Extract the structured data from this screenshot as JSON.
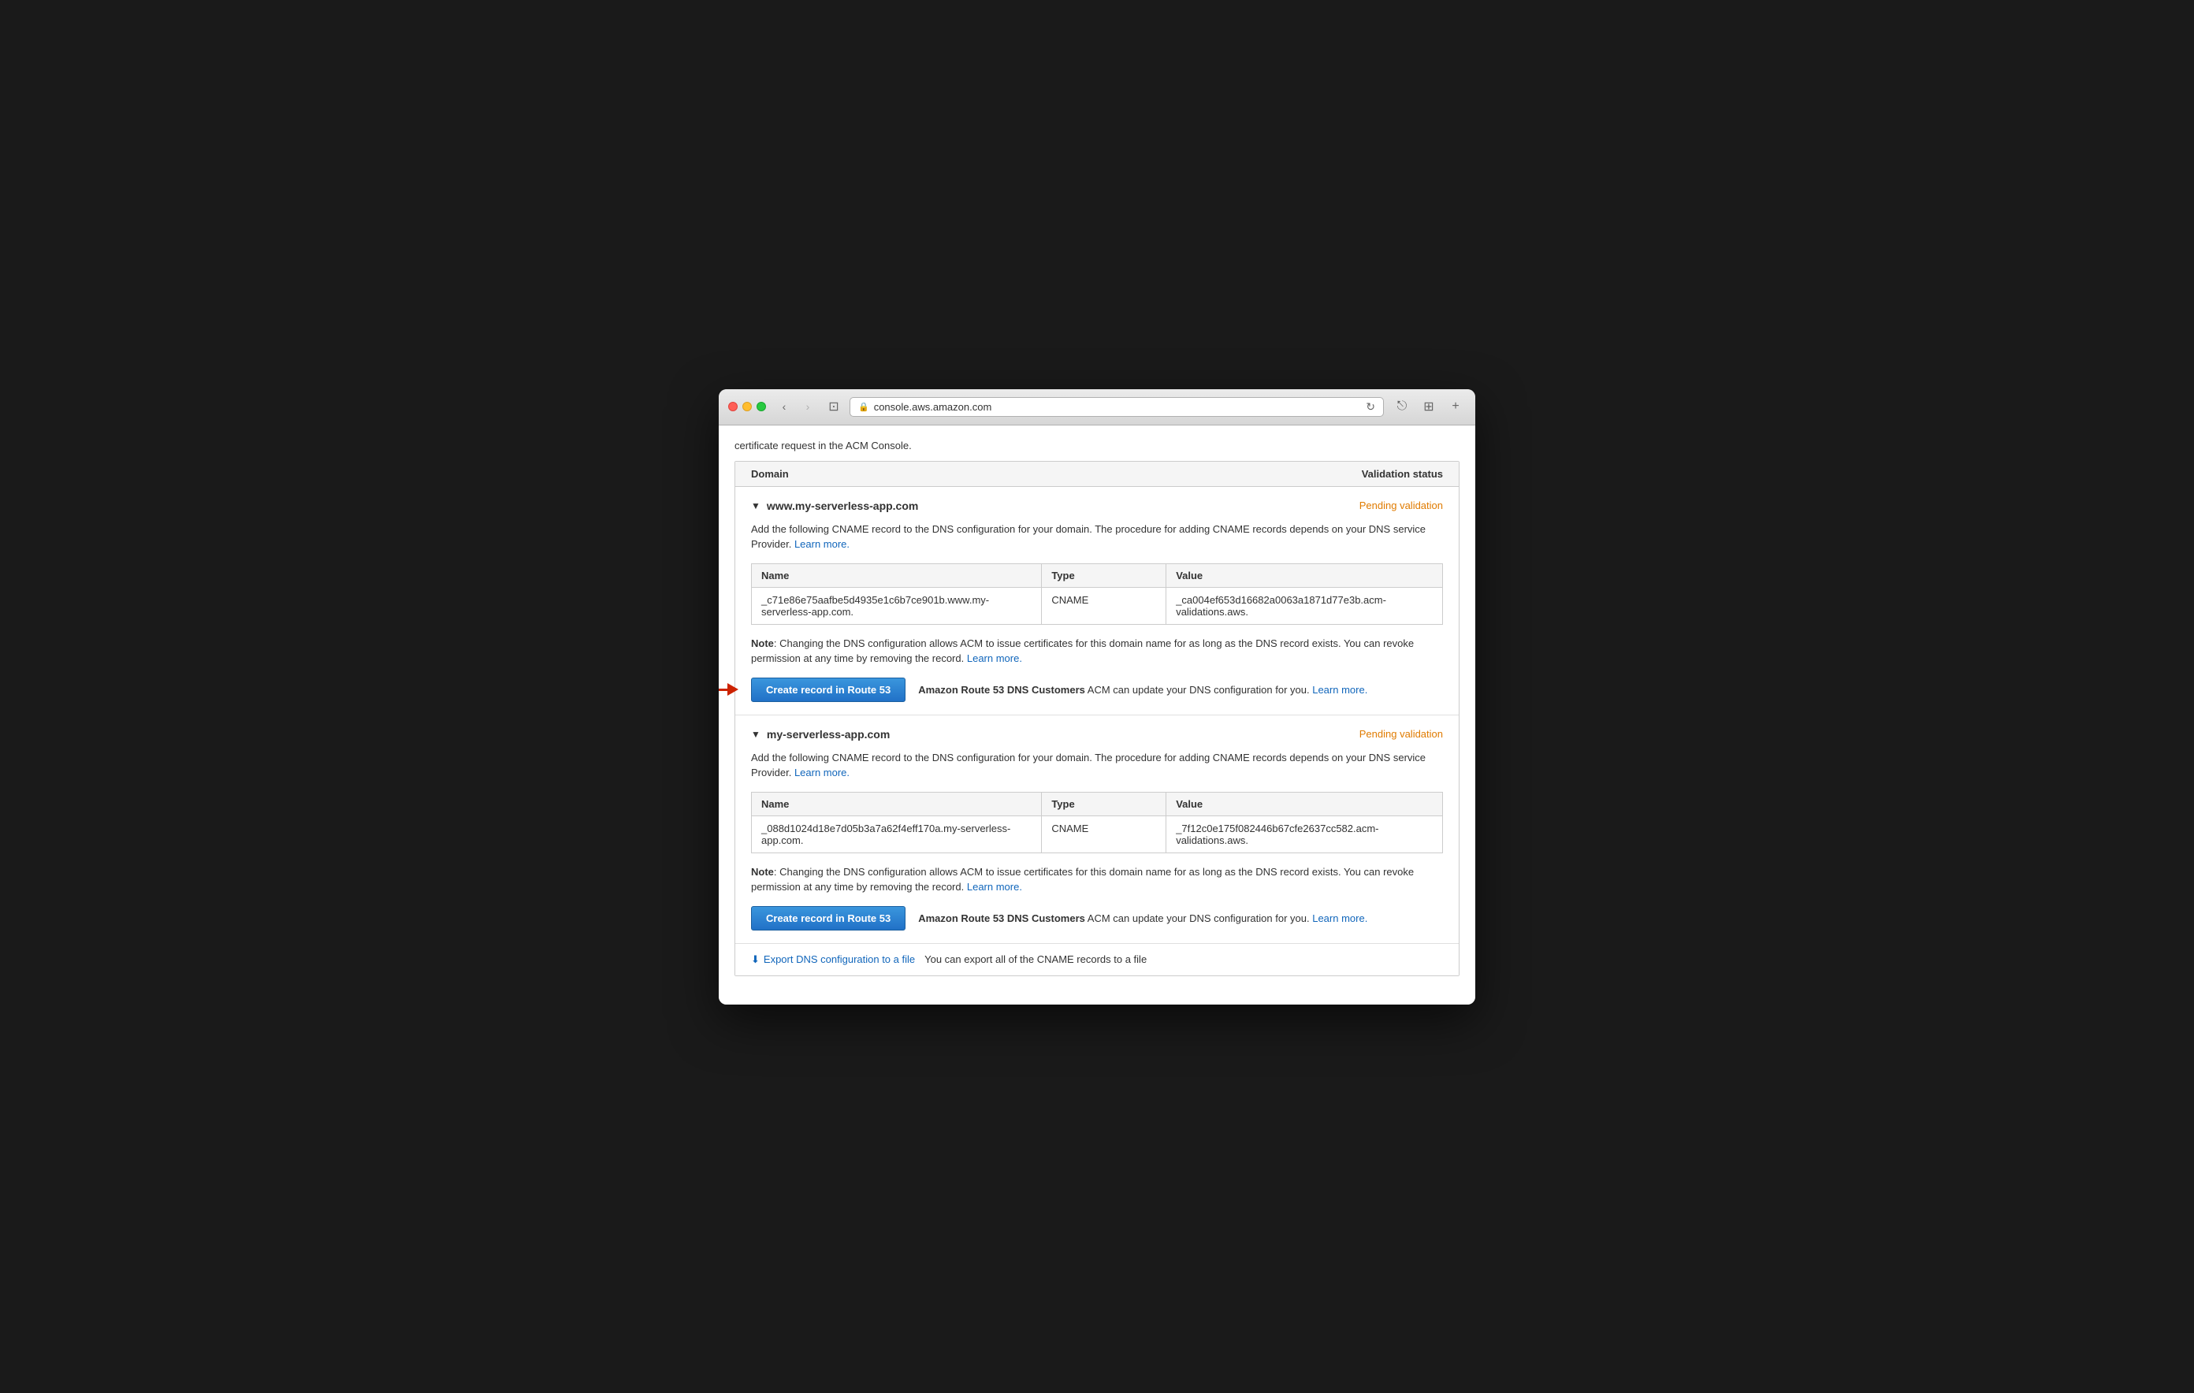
{
  "browser": {
    "url": "console.aws.amazon.com",
    "nav_back_disabled": false,
    "nav_forward_disabled": true
  },
  "page": {
    "cutoff_text": "certificate request in the ACM Console.",
    "table_headers": {
      "domain": "Domain",
      "validation_status": "Validation status"
    },
    "section1": {
      "domain": "www.my-serverless-app.com",
      "validation_status": "Pending validation",
      "description": "Add the following CNAME record to the DNS configuration for your domain. The procedure for adding CNAME records depends on your DNS service Provider.",
      "learn_more_label": "Learn more.",
      "cname_table": {
        "col_name": "Name",
        "col_type": "Type",
        "col_value": "Value",
        "row": {
          "name": "_c71e86e75aafbe5d4935e1c6b7ce901b.www.my-serverless-app.com.",
          "type": "CNAME",
          "value": "_ca004ef653d16682a0063a1871d77e3b.acm-validations.aws."
        }
      },
      "note_text": "Changing the DNS configuration allows ACM to issue certificates for this domain name for as long as the DNS record exists. You can revoke permission at any time by removing the record.",
      "note_learn_more": "Learn more.",
      "create_btn": "Create record in Route 53",
      "customers_label": "Amazon Route 53 DNS Customers",
      "customers_text": "ACM can update your DNS configuration for you.",
      "customers_learn_more": "Learn more."
    },
    "section2": {
      "domain": "my-serverless-app.com",
      "validation_status": "Pending validation",
      "description": "Add the following CNAME record to the DNS configuration for your domain. The procedure for adding CNAME records depends on your DNS service Provider.",
      "learn_more_label": "Learn more.",
      "cname_table": {
        "col_name": "Name",
        "col_type": "Type",
        "col_value": "Value",
        "row": {
          "name": "_088d1024d18e7d05b3a7a62f4eff170a.my-serverless-app.com.",
          "type": "CNAME",
          "value": "_7f12c0e175f082446b67cfe2637cc582.acm-validations.aws."
        }
      },
      "note_text": "Changing the DNS configuration allows ACM to issue certificates for this domain name for as long as the DNS record exists. You can revoke permission at any time by removing the record.",
      "note_learn_more": "Learn more.",
      "create_btn": "Create record in Route 53",
      "customers_label": "Amazon Route 53 DNS Customers",
      "customers_text": "ACM can update your DNS configuration for you.",
      "customers_learn_more": "Learn more."
    },
    "export": {
      "link_text": "Export DNS configuration to a file",
      "description": "You can export all of the CNAME records to a file"
    }
  },
  "icons": {
    "lock": "🔒",
    "reload": "↻",
    "share": "⎋",
    "tabs": "⊞",
    "new_tab": "+",
    "back": "‹",
    "forward": "›",
    "sidebar": "⊡",
    "chevron_down": "▼",
    "download": "⬇"
  }
}
